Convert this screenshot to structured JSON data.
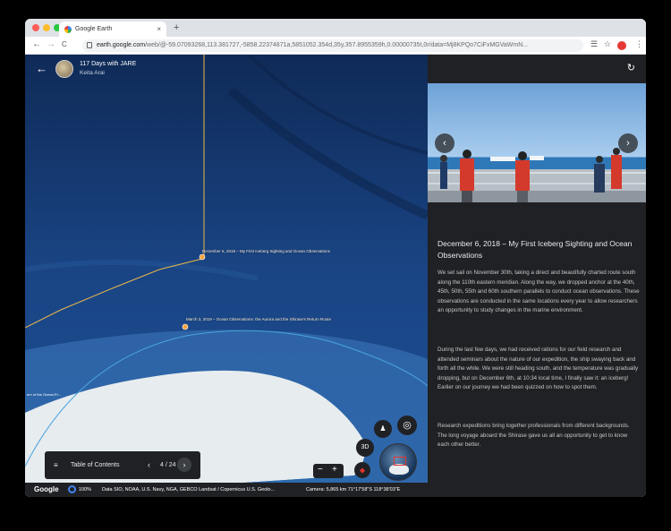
{
  "browser": {
    "tab_title": "Google Earth",
    "tab_close": "×",
    "new_tab": "+",
    "back": "←",
    "forward": "→",
    "reload": "C",
    "url_domain": "earth.google.com",
    "url_rest": "/web/@-59.07093268,113.381727,-5858.22374871a,5851052.354d,35y,357.8955359h,0.00000735t,0r/data=Mj8KPQo7CiFxMGVaWmN...",
    "menu": "⋮"
  },
  "story": {
    "back": "←",
    "title": "117 Days with JARE",
    "author": "Keita Arai"
  },
  "map": {
    "pin1_label": "December 6, 2018 – My First Iceberg Sighting and Ocean Observations",
    "pin2_label": "March 3, 2019 – Ocean Observations: the Aurora and the Shirase's Return Route",
    "coast_label": "ern of the Ocean,Pr...",
    "colors": {
      "ocean": "#163766",
      "route_yellow": "#e9b84a",
      "route_blue": "#4aa3df",
      "ice": "#e9edf0"
    }
  },
  "toc": {
    "icon": "≡",
    "label": "Table of Contents",
    "prev": "‹",
    "counter": "4 / 24",
    "next": "›"
  },
  "controls": {
    "mode_3d": "3D",
    "pegman": "♟",
    "location": "◎",
    "zoom_out": "−",
    "zoom_in": "+",
    "compass": "⬥"
  },
  "status": {
    "google": "Google",
    "percent": "100%",
    "attribution": "Data SIO, NOAA, U.S. Navy, NGA, GEBCO   Landsat / Copernicus   U.S. Geolo...",
    "camera": "Camera: 5,865 km   71°17'58\"S 118°38'03\"E"
  },
  "panel": {
    "refresh": "↻",
    "prev_arrow": "‹",
    "next_arrow": "›",
    "heading": "December 6, 2018 – My First Iceberg Sighting and Ocean Observations",
    "paragraphs": [
      "We set sail on November 30th, taking a direct and beautifully charted route south along the 110th eastern meridian. Along the way, we dropped anchor at the 40th, 45th, 50th, 55th and 60th southern parallels to conduct ocean observations. These observations are conducted in the same locations every year to allow researchers an opportunity to study changes in the marine environment.",
      "During the last few days, we had received rations for our field research and attended seminars about the nature of our expedition, the ship swaying back and forth all the while. We were still heading south, and the temperature was gradually dropping, but on December 6th, at 10:34 local time, I finally saw it: an iceberg! Earlier on our journey we had been quizzed on how to spot them.",
      "Research expeditions bring together professionals from different backgrounds. The long voyage aboard the Shirase gave us all an opportunity to get to know each other better."
    ]
  }
}
